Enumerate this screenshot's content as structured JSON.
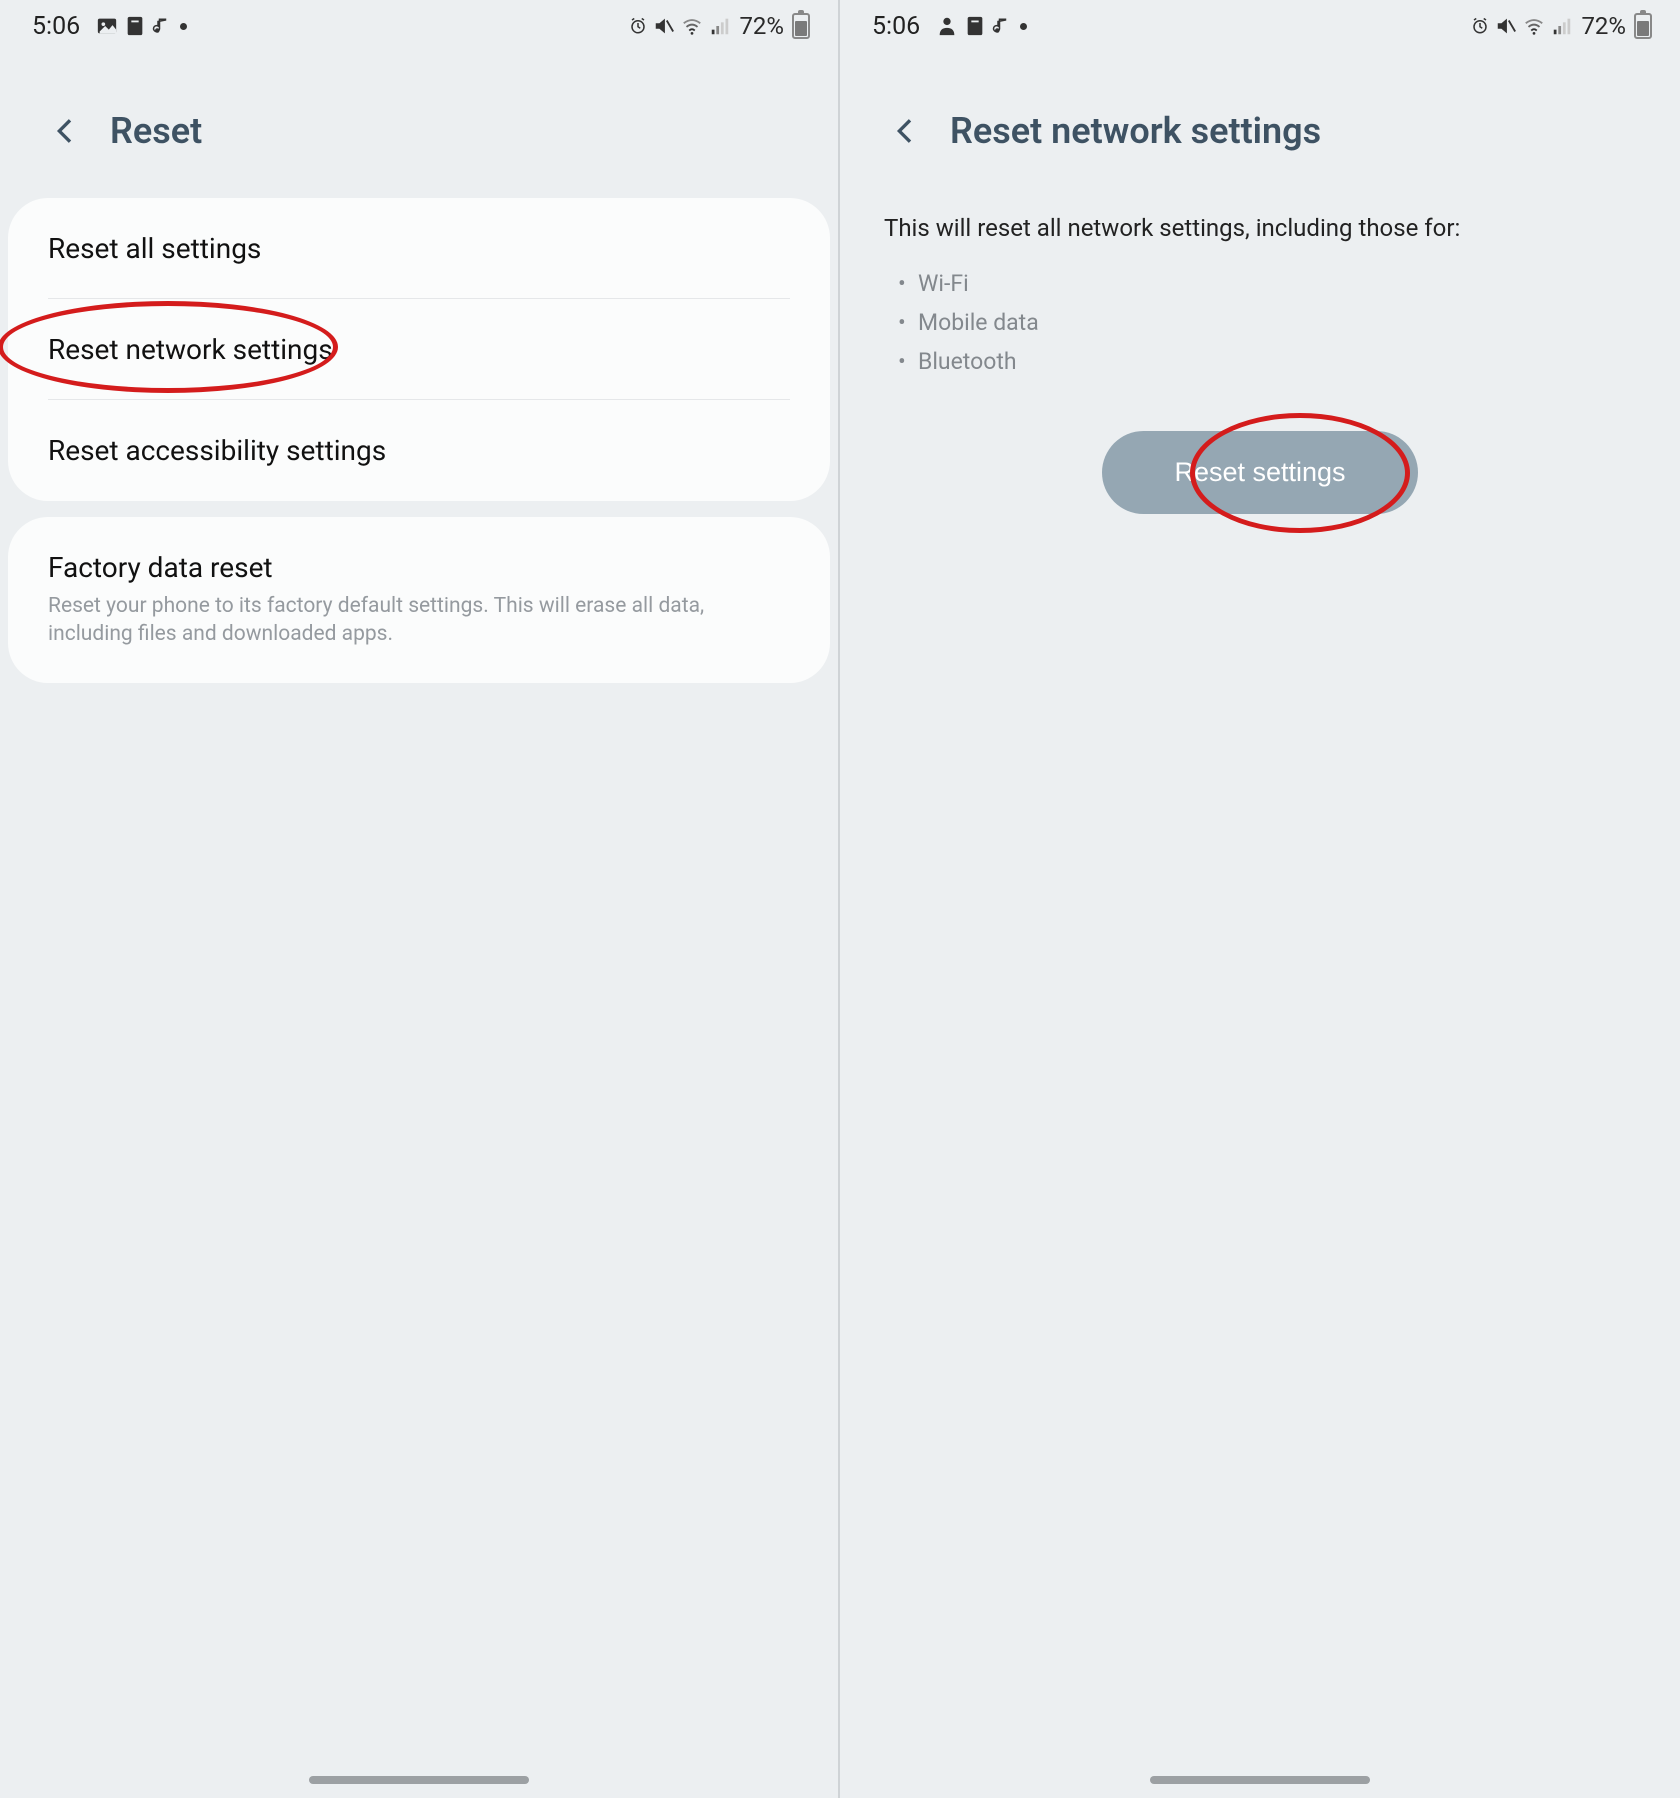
{
  "status": {
    "time": "5:06",
    "battery": "72%"
  },
  "left": {
    "title": "Reset",
    "items": {
      "reset_all": "Reset all settings",
      "reset_network": "Reset network settings",
      "reset_accessibility": "Reset accessibility settings"
    },
    "factory": {
      "title": "Factory data reset",
      "desc": "Reset your phone to its factory default settings. This will erase all data, including files and downloaded apps."
    }
  },
  "right": {
    "title": "Reset network settings",
    "desc": "This will reset all network settings, including those for:",
    "bullets": {
      "wifi": "Wi-Fi",
      "mobile": "Mobile data",
      "bluetooth": "Bluetooth"
    },
    "button": "Reset settings"
  }
}
